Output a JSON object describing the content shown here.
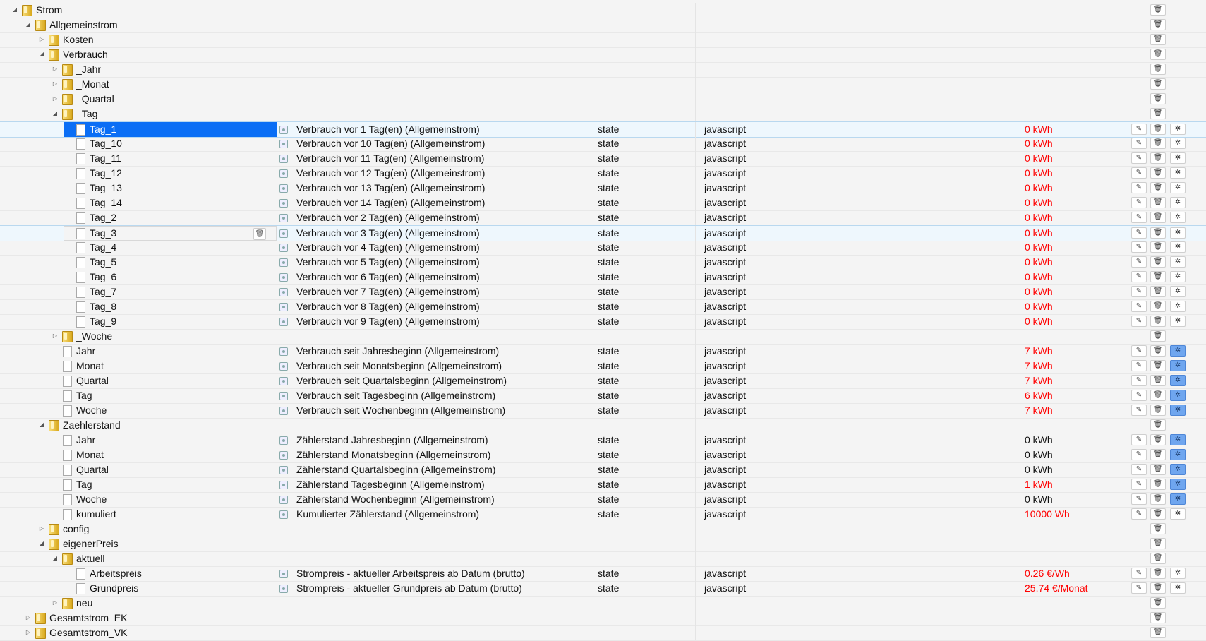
{
  "tree": [
    {
      "level": 0,
      "type": "folder",
      "expanded": true,
      "name": "Strom"
    },
    {
      "level": 1,
      "type": "folder",
      "expanded": true,
      "name": "Allgemeinstrom"
    },
    {
      "level": 2,
      "type": "folder",
      "expanded": false,
      "name": "Kosten"
    },
    {
      "level": 2,
      "type": "folder",
      "expanded": true,
      "name": "Verbrauch"
    },
    {
      "level": 3,
      "type": "folder",
      "expanded": false,
      "name": "_Jahr"
    },
    {
      "level": 3,
      "type": "folder",
      "expanded": false,
      "name": "_Monat"
    },
    {
      "level": 3,
      "type": "folder",
      "expanded": false,
      "name": "_Quartal"
    },
    {
      "level": 3,
      "type": "folder",
      "expanded": true,
      "name": "_Tag"
    },
    {
      "level": 4,
      "type": "state",
      "name": "Tag_1",
      "desc": "Verbrauch vor 1 Tag(en) (Allgemeinstrom)",
      "obj_type": "state",
      "role": "javascript",
      "value": "0 kWh",
      "value_red": true,
      "cfg_on": false,
      "selected": true
    },
    {
      "level": 4,
      "type": "state",
      "name": "Tag_10",
      "desc": "Verbrauch vor 10 Tag(en) (Allgemeinstrom)",
      "obj_type": "state",
      "role": "javascript",
      "value": "0 kWh",
      "value_red": true,
      "cfg_on": false
    },
    {
      "level": 4,
      "type": "state",
      "name": "Tag_11",
      "desc": "Verbrauch vor 11 Tag(en) (Allgemeinstrom)",
      "obj_type": "state",
      "role": "javascript",
      "value": "0 kWh",
      "value_red": true,
      "cfg_on": false
    },
    {
      "level": 4,
      "type": "state",
      "name": "Tag_12",
      "desc": "Verbrauch vor 12 Tag(en) (Allgemeinstrom)",
      "obj_type": "state",
      "role": "javascript",
      "value": "0 kWh",
      "value_red": true,
      "cfg_on": false
    },
    {
      "level": 4,
      "type": "state",
      "name": "Tag_13",
      "desc": "Verbrauch vor 13 Tag(en) (Allgemeinstrom)",
      "obj_type": "state",
      "role": "javascript",
      "value": "0 kWh",
      "value_red": true,
      "cfg_on": false
    },
    {
      "level": 4,
      "type": "state",
      "name": "Tag_14",
      "desc": "Verbrauch vor 14 Tag(en) (Allgemeinstrom)",
      "obj_type": "state",
      "role": "javascript",
      "value": "0 kWh",
      "value_red": true,
      "cfg_on": false
    },
    {
      "level": 4,
      "type": "state",
      "name": "Tag_2",
      "desc": "Verbrauch vor 2 Tag(en) (Allgemeinstrom)",
      "obj_type": "state",
      "role": "javascript",
      "value": "0 kWh",
      "value_red": true,
      "cfg_on": false
    },
    {
      "level": 4,
      "type": "state",
      "name": "Tag_3",
      "desc": "Verbrauch vor 3 Tag(en) (Allgemeinstrom)",
      "obj_type": "state",
      "role": "javascript",
      "value": "0 kWh",
      "value_red": true,
      "cfg_on": false,
      "hover": true
    },
    {
      "level": 4,
      "type": "state",
      "name": "Tag_4",
      "desc": "Verbrauch vor 4 Tag(en) (Allgemeinstrom)",
      "obj_type": "state",
      "role": "javascript",
      "value": "0 kWh",
      "value_red": true,
      "cfg_on": false
    },
    {
      "level": 4,
      "type": "state",
      "name": "Tag_5",
      "desc": "Verbrauch vor 5 Tag(en) (Allgemeinstrom)",
      "obj_type": "state",
      "role": "javascript",
      "value": "0 kWh",
      "value_red": true,
      "cfg_on": false
    },
    {
      "level": 4,
      "type": "state",
      "name": "Tag_6",
      "desc": "Verbrauch vor 6 Tag(en) (Allgemeinstrom)",
      "obj_type": "state",
      "role": "javascript",
      "value": "0 kWh",
      "value_red": true,
      "cfg_on": false
    },
    {
      "level": 4,
      "type": "state",
      "name": "Tag_7",
      "desc": "Verbrauch vor 7 Tag(en) (Allgemeinstrom)",
      "obj_type": "state",
      "role": "javascript",
      "value": "0 kWh",
      "value_red": true,
      "cfg_on": false
    },
    {
      "level": 4,
      "type": "state",
      "name": "Tag_8",
      "desc": "Verbrauch vor 8 Tag(en) (Allgemeinstrom)",
      "obj_type": "state",
      "role": "javascript",
      "value": "0 kWh",
      "value_red": true,
      "cfg_on": false
    },
    {
      "level": 4,
      "type": "state",
      "name": "Tag_9",
      "desc": "Verbrauch vor 9 Tag(en) (Allgemeinstrom)",
      "obj_type": "state",
      "role": "javascript",
      "value": "0 kWh",
      "value_red": true,
      "cfg_on": false
    },
    {
      "level": 3,
      "type": "folder",
      "expanded": false,
      "name": "_Woche"
    },
    {
      "level": 3,
      "type": "state",
      "name": "Jahr",
      "desc": "Verbrauch seit Jahresbeginn (Allgemeinstrom)",
      "obj_type": "state",
      "role": "javascript",
      "value": "7 kWh",
      "value_red": true,
      "cfg_on": true
    },
    {
      "level": 3,
      "type": "state",
      "name": "Monat",
      "desc": "Verbrauch seit Monatsbeginn (Allgemeinstrom)",
      "obj_type": "state",
      "role": "javascript",
      "value": "7 kWh",
      "value_red": true,
      "cfg_on": true
    },
    {
      "level": 3,
      "type": "state",
      "name": "Quartal",
      "desc": "Verbrauch seit Quartalsbeginn (Allgemeinstrom)",
      "obj_type": "state",
      "role": "javascript",
      "value": "7 kWh",
      "value_red": true,
      "cfg_on": true
    },
    {
      "level": 3,
      "type": "state",
      "name": "Tag",
      "desc": "Verbrauch seit Tagesbeginn (Allgemeinstrom)",
      "obj_type": "state",
      "role": "javascript",
      "value": "6 kWh",
      "value_red": true,
      "cfg_on": true
    },
    {
      "level": 3,
      "type": "state",
      "name": "Woche",
      "desc": "Verbrauch seit Wochenbeginn (Allgemeinstrom)",
      "obj_type": "state",
      "role": "javascript",
      "value": "7 kWh",
      "value_red": true,
      "cfg_on": true
    },
    {
      "level": 2,
      "type": "folder",
      "expanded": true,
      "name": "Zaehlerstand"
    },
    {
      "level": 3,
      "type": "state",
      "name": "Jahr",
      "desc": "Zählerstand Jahresbeginn (Allgemeinstrom)",
      "obj_type": "state",
      "role": "javascript",
      "value": "0 kWh",
      "value_red": false,
      "cfg_on": true
    },
    {
      "level": 3,
      "type": "state",
      "name": "Monat",
      "desc": "Zählerstand Monatsbeginn (Allgemeinstrom)",
      "obj_type": "state",
      "role": "javascript",
      "value": "0 kWh",
      "value_red": false,
      "cfg_on": true
    },
    {
      "level": 3,
      "type": "state",
      "name": "Quartal",
      "desc": "Zählerstand Quartalsbeginn (Allgemeinstrom)",
      "obj_type": "state",
      "role": "javascript",
      "value": "0 kWh",
      "value_red": false,
      "cfg_on": true
    },
    {
      "level": 3,
      "type": "state",
      "name": "Tag",
      "desc": "Zählerstand Tagesbeginn (Allgemeinstrom)",
      "obj_type": "state",
      "role": "javascript",
      "value": "1 kWh",
      "value_red": true,
      "cfg_on": true
    },
    {
      "level": 3,
      "type": "state",
      "name": "Woche",
      "desc": "Zählerstand Wochenbeginn (Allgemeinstrom)",
      "obj_type": "state",
      "role": "javascript",
      "value": "0 kWh",
      "value_red": false,
      "cfg_on": true
    },
    {
      "level": 3,
      "type": "state",
      "name": "kumuliert",
      "desc": "Kumulierter Zählerstand (Allgemeinstrom)",
      "obj_type": "state",
      "role": "javascript",
      "value": "10000 Wh",
      "value_red": true,
      "cfg_on": false
    },
    {
      "level": 2,
      "type": "folder",
      "expanded": false,
      "name": "config"
    },
    {
      "level": 2,
      "type": "folder",
      "expanded": true,
      "name": "eigenerPreis"
    },
    {
      "level": 3,
      "type": "folder",
      "expanded": true,
      "name": "aktuell"
    },
    {
      "level": 4,
      "type": "state",
      "name": "Arbeitspreis",
      "desc": "Strompreis - aktueller Arbeitspreis ab Datum (brutto)",
      "obj_type": "state",
      "role": "javascript",
      "value": "0.26 €/Wh",
      "value_red": true,
      "cfg_on": false
    },
    {
      "level": 4,
      "type": "state",
      "name": "Grundpreis",
      "desc": "Strompreis - aktueller Grundpreis ab Datum (brutto)",
      "obj_type": "state",
      "role": "javascript",
      "value": "25.74 €/Monat",
      "value_red": true,
      "cfg_on": false
    },
    {
      "level": 3,
      "type": "folder",
      "expanded": false,
      "name": "neu"
    },
    {
      "level": 1,
      "type": "folder",
      "expanded": false,
      "name": "Gesamtstrom_EK"
    },
    {
      "level": 1,
      "type": "folder",
      "expanded": false,
      "name": "Gesamtstrom_VK"
    }
  ],
  "icons": {
    "expanded": "◢",
    "collapsed": "▷",
    "edit": "✎",
    "delete": "🗑",
    "config": "✲",
    "trash_inline": "🗑"
  }
}
